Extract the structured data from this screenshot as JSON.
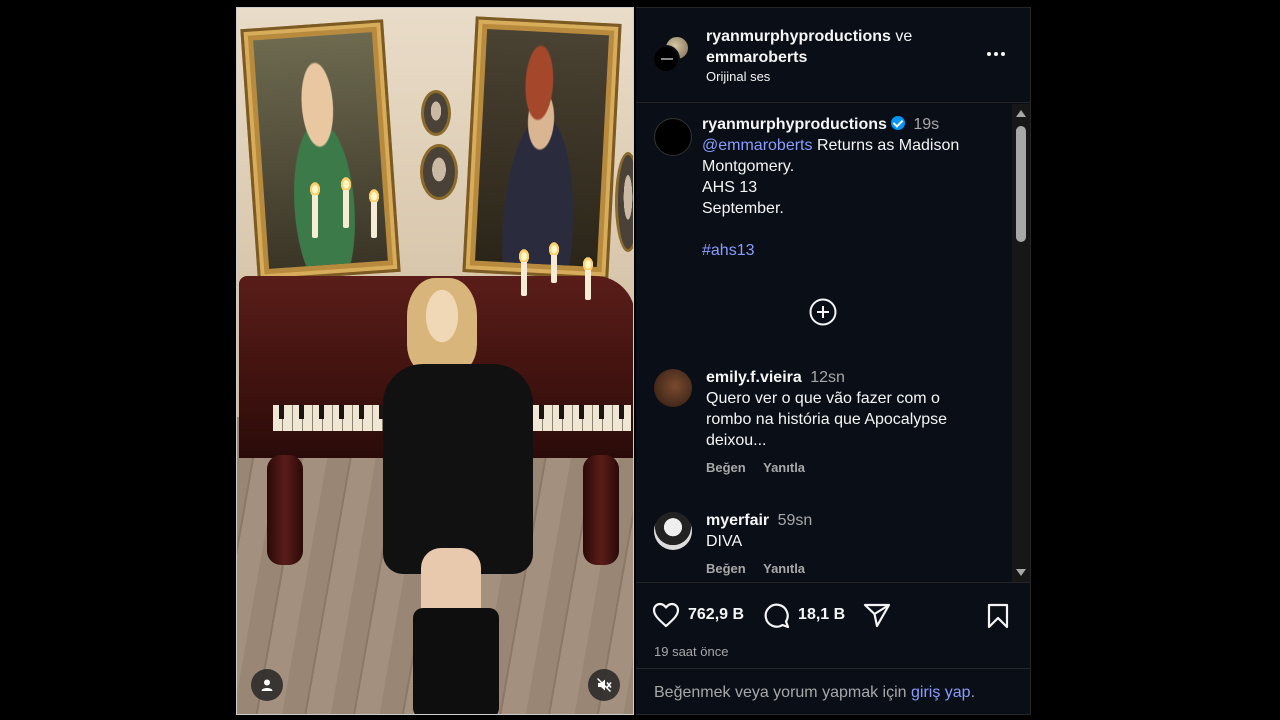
{
  "post_header": {
    "author_primary": "ryanmurphyproductions",
    "connector": "ve",
    "author_secondary": "emmaroberts",
    "audio": "Orijinal ses"
  },
  "caption": {
    "username": "ryanmurphyproductions",
    "time": "19s",
    "mention": "@emmaroberts",
    "line1_rest": " Returns as Madison",
    "line2": "Montgomery.",
    "line3": "AHS 13",
    "line4": "September.",
    "hashtag": "#ahs13"
  },
  "comments": [
    {
      "username": "emily.f.vieira",
      "time": "12sn",
      "lines": [
        "Quero ver o que vão fazer com o",
        "rombo na história que Apocalypse",
        "deixou..."
      ],
      "like_label": "Beğen",
      "reply_label": "Yanıtla"
    },
    {
      "username": "myerfair",
      "time": "59sn",
      "lines": [
        "DIVA"
      ],
      "like_label": "Beğen",
      "reply_label": "Yanıtla"
    }
  ],
  "actions": {
    "likes": "762,9 B",
    "comments": "18,1 B"
  },
  "timestamp": "19 saat önce",
  "login_prompt": {
    "prefix": "Beğenmek veya yorum yapmak için ",
    "link": "giriş yap",
    "suffix": "."
  },
  "colors": {
    "panel_bg": "#0a0e17",
    "link": "#8a9dff",
    "verified": "#0095f6",
    "muted_text": "#a8a8a8"
  },
  "icons": [
    "heart-icon",
    "comment-icon",
    "share-icon",
    "bookmark-icon",
    "more-icon",
    "add-circle-icon",
    "profile-icon",
    "muted-icon",
    "verified-icon"
  ]
}
